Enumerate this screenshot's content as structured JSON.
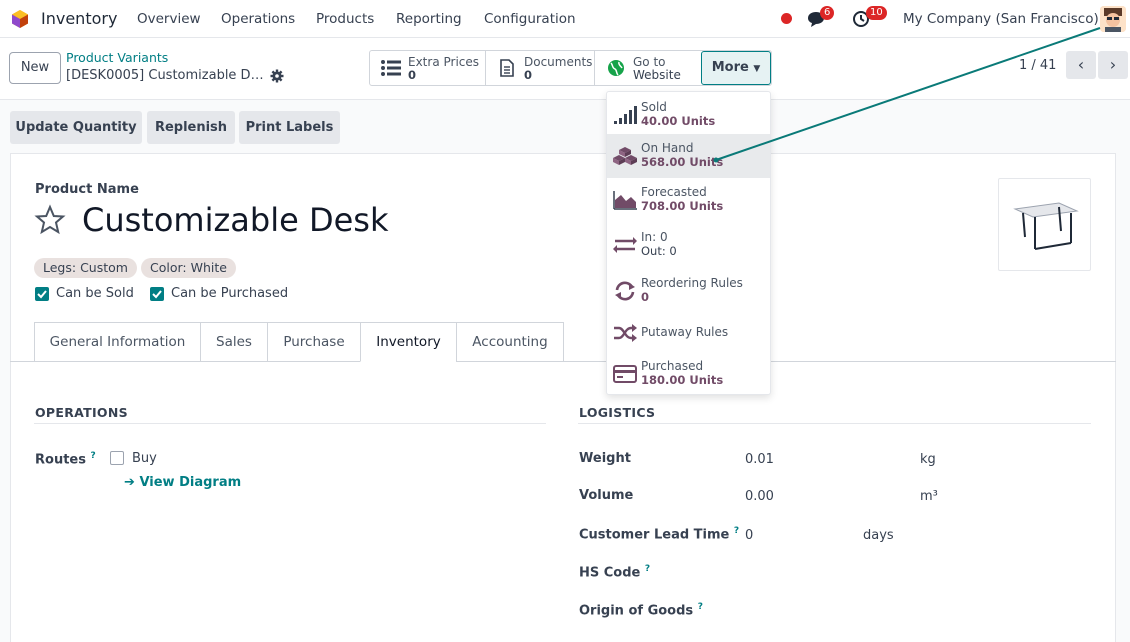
{
  "app": {
    "name": "Inventory"
  },
  "menu": [
    "Overview",
    "Operations",
    "Products",
    "Reporting",
    "Configuration"
  ],
  "systray": {
    "messages_count": "6",
    "activities_count": "10",
    "company": "My Company (San Francisco)"
  },
  "control": {
    "new_label": "New",
    "breadcrumb": "Product Variants",
    "record": "[DESK0005] Customizable D…",
    "pager": "1 / 41"
  },
  "smart_buttons": [
    {
      "label": "Extra Prices",
      "value": "0",
      "icon": "list-icon"
    },
    {
      "label": "Documents",
      "value": "0",
      "icon": "document-icon"
    },
    {
      "label": "Go to",
      "value": "Website",
      "icon": "globe-icon"
    }
  ],
  "more_label": "More",
  "more_menu": [
    {
      "label": "Sold",
      "value": "40.00 Units",
      "icon": "signal-icon"
    },
    {
      "label": "On Hand",
      "value": "568.00 Units",
      "icon": "cubes-icon"
    },
    {
      "label": "Forecasted",
      "value": "708.00 Units",
      "icon": "area-chart-icon"
    },
    {
      "label": "In: 0",
      "value": "Out: 0",
      "icon": "exchange-icon"
    },
    {
      "label": "Reordering Rules",
      "value": "0",
      "icon": "refresh-icon"
    },
    {
      "label": "Putaway Rules",
      "value": "",
      "icon": "random-icon"
    },
    {
      "label": "Purchased",
      "value": "180.00 Units",
      "icon": "credit-card-icon"
    }
  ],
  "actions": [
    "Update Quantity",
    "Replenish",
    "Print Labels"
  ],
  "product": {
    "name_label": "Product Name",
    "name": "Customizable Desk",
    "tags": [
      "Legs: Custom",
      "Color: White"
    ],
    "can_be_sold": "Can be Sold",
    "can_be_purchased": "Can be Purchased"
  },
  "tabs": [
    "General Information",
    "Sales",
    "Purchase",
    "Inventory",
    "Accounting"
  ],
  "active_tab": "Inventory",
  "operations": {
    "title": "OPERATIONS",
    "routes_label": "Routes",
    "route_buy": "Buy",
    "view_diagram": "View Diagram"
  },
  "logistics": {
    "title": "LOGISTICS",
    "weight_label": "Weight",
    "weight": "0.01",
    "weight_unit": "kg",
    "volume_label": "Volume",
    "volume": "0.00",
    "volume_unit": "m³",
    "lead_label": "Customer Lead Time",
    "lead": "0",
    "lead_unit": "days",
    "hs_label": "HS Code",
    "origin_label": "Origin of Goods"
  },
  "colors": {
    "primary": "#017e84",
    "brand": "#714b67",
    "arrow": "#0a7a78"
  }
}
